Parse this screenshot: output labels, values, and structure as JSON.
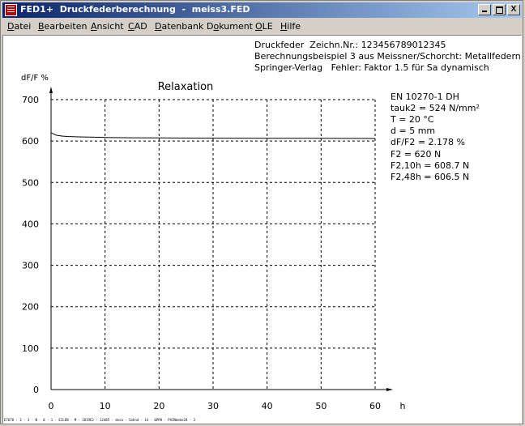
{
  "window": {
    "title": "FED1+  Druckfederberechnung  -  meiss3.FED",
    "buttons": {
      "close": "X"
    }
  },
  "menu": [
    {
      "underline": "D",
      "rest": "atei"
    },
    {
      "underline": "B",
      "rest": "earbeiten"
    },
    {
      "underline": "A",
      "rest": "nsicht"
    },
    {
      "underline": "C",
      "rest": "AD"
    },
    {
      "underline": "D",
      "rest": "atenbank"
    },
    {
      "pre": "D",
      "underline": "o",
      "rest": "kument"
    },
    {
      "underline": "O",
      "rest": "LE"
    },
    {
      "underline": "H",
      "rest": "ilfe"
    }
  ],
  "header": {
    "line1": "Druckfeder  Zeichn.Nr.: 123456789012345",
    "line2": "Berechnungsbeispiel 3 aus Meissner/Schorcht: Metallfedern",
    "line3": "Springer-Verlag   Fehler: Faktor 1.5 für Sa dynamisch"
  },
  "info": [
    "EN 10270-1 DH",
    "tauk2 = 524 N/mm²",
    "T = 20 °C",
    "d = 5 mm",
    "dF/F2 = 2.178 %",
    "F2 = 620 N",
    "F2,10h = 608.7 N",
    "F2,48h = 606.5 N"
  ],
  "chart_data": {
    "type": "line",
    "title": "Relaxation",
    "xlabel": "h",
    "ylabel": "dF/F %",
    "xlim": [
      0,
      60
    ],
    "ylim": [
      0,
      700
    ],
    "xticks": [
      0,
      10,
      20,
      30,
      40,
      50,
      60
    ],
    "yticks": [
      0,
      100,
      200,
      300,
      400,
      500,
      600,
      700
    ],
    "grid": true,
    "grid_style": "dashed",
    "series": [
      {
        "x": [
          0,
          0.5,
          1,
          2,
          3,
          5,
          8,
          10,
          15,
          20,
          30,
          40,
          48,
          60
        ],
        "y": [
          620,
          617,
          614,
          612,
          611,
          610,
          609.2,
          608.7,
          608,
          607.5,
          607,
          606.7,
          606.5,
          606.2
        ]
      }
    ]
  },
  "status_text": "E7678 · 3 · 3 · N · 0 · 1 · EILEN · M · 1819E2 · 12485 · dosa · Sahnd · 14 · &PPH · PAINmeke28 · 3"
}
